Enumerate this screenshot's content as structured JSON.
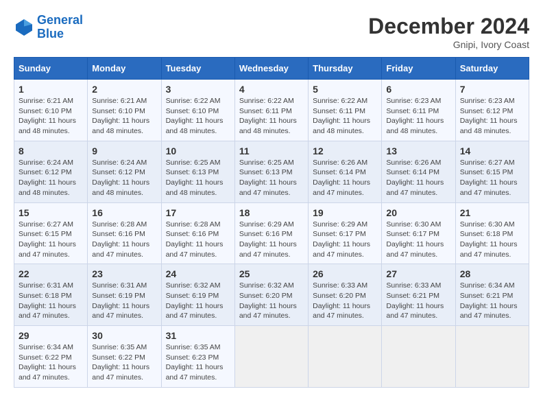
{
  "logo": {
    "line1": "General",
    "line2": "Blue"
  },
  "title": "December 2024",
  "subtitle": "Gnipi, Ivory Coast",
  "days_header": [
    "Sunday",
    "Monday",
    "Tuesday",
    "Wednesday",
    "Thursday",
    "Friday",
    "Saturday"
  ],
  "weeks": [
    [
      {
        "day": "1",
        "info": "Sunrise: 6:21 AM\nSunset: 6:10 PM\nDaylight: 11 hours\nand 48 minutes."
      },
      {
        "day": "2",
        "info": "Sunrise: 6:21 AM\nSunset: 6:10 PM\nDaylight: 11 hours\nand 48 minutes."
      },
      {
        "day": "3",
        "info": "Sunrise: 6:22 AM\nSunset: 6:10 PM\nDaylight: 11 hours\nand 48 minutes."
      },
      {
        "day": "4",
        "info": "Sunrise: 6:22 AM\nSunset: 6:11 PM\nDaylight: 11 hours\nand 48 minutes."
      },
      {
        "day": "5",
        "info": "Sunrise: 6:22 AM\nSunset: 6:11 PM\nDaylight: 11 hours\nand 48 minutes."
      },
      {
        "day": "6",
        "info": "Sunrise: 6:23 AM\nSunset: 6:11 PM\nDaylight: 11 hours\nand 48 minutes."
      },
      {
        "day": "7",
        "info": "Sunrise: 6:23 AM\nSunset: 6:12 PM\nDaylight: 11 hours\nand 48 minutes."
      }
    ],
    [
      {
        "day": "8",
        "info": "Sunrise: 6:24 AM\nSunset: 6:12 PM\nDaylight: 11 hours\nand 48 minutes."
      },
      {
        "day": "9",
        "info": "Sunrise: 6:24 AM\nSunset: 6:12 PM\nDaylight: 11 hours\nand 48 minutes."
      },
      {
        "day": "10",
        "info": "Sunrise: 6:25 AM\nSunset: 6:13 PM\nDaylight: 11 hours\nand 48 minutes."
      },
      {
        "day": "11",
        "info": "Sunrise: 6:25 AM\nSunset: 6:13 PM\nDaylight: 11 hours\nand 47 minutes."
      },
      {
        "day": "12",
        "info": "Sunrise: 6:26 AM\nSunset: 6:14 PM\nDaylight: 11 hours\nand 47 minutes."
      },
      {
        "day": "13",
        "info": "Sunrise: 6:26 AM\nSunset: 6:14 PM\nDaylight: 11 hours\nand 47 minutes."
      },
      {
        "day": "14",
        "info": "Sunrise: 6:27 AM\nSunset: 6:15 PM\nDaylight: 11 hours\nand 47 minutes."
      }
    ],
    [
      {
        "day": "15",
        "info": "Sunrise: 6:27 AM\nSunset: 6:15 PM\nDaylight: 11 hours\nand 47 minutes."
      },
      {
        "day": "16",
        "info": "Sunrise: 6:28 AM\nSunset: 6:16 PM\nDaylight: 11 hours\nand 47 minutes."
      },
      {
        "day": "17",
        "info": "Sunrise: 6:28 AM\nSunset: 6:16 PM\nDaylight: 11 hours\nand 47 minutes."
      },
      {
        "day": "18",
        "info": "Sunrise: 6:29 AM\nSunset: 6:16 PM\nDaylight: 11 hours\nand 47 minutes."
      },
      {
        "day": "19",
        "info": "Sunrise: 6:29 AM\nSunset: 6:17 PM\nDaylight: 11 hours\nand 47 minutes."
      },
      {
        "day": "20",
        "info": "Sunrise: 6:30 AM\nSunset: 6:17 PM\nDaylight: 11 hours\nand 47 minutes."
      },
      {
        "day": "21",
        "info": "Sunrise: 6:30 AM\nSunset: 6:18 PM\nDaylight: 11 hours\nand 47 minutes."
      }
    ],
    [
      {
        "day": "22",
        "info": "Sunrise: 6:31 AM\nSunset: 6:18 PM\nDaylight: 11 hours\nand 47 minutes."
      },
      {
        "day": "23",
        "info": "Sunrise: 6:31 AM\nSunset: 6:19 PM\nDaylight: 11 hours\nand 47 minutes."
      },
      {
        "day": "24",
        "info": "Sunrise: 6:32 AM\nSunset: 6:19 PM\nDaylight: 11 hours\nand 47 minutes."
      },
      {
        "day": "25",
        "info": "Sunrise: 6:32 AM\nSunset: 6:20 PM\nDaylight: 11 hours\nand 47 minutes."
      },
      {
        "day": "26",
        "info": "Sunrise: 6:33 AM\nSunset: 6:20 PM\nDaylight: 11 hours\nand 47 minutes."
      },
      {
        "day": "27",
        "info": "Sunrise: 6:33 AM\nSunset: 6:21 PM\nDaylight: 11 hours\nand 47 minutes."
      },
      {
        "day": "28",
        "info": "Sunrise: 6:34 AM\nSunset: 6:21 PM\nDaylight: 11 hours\nand 47 minutes."
      }
    ],
    [
      {
        "day": "29",
        "info": "Sunrise: 6:34 AM\nSunset: 6:22 PM\nDaylight: 11 hours\nand 47 minutes."
      },
      {
        "day": "30",
        "info": "Sunrise: 6:35 AM\nSunset: 6:22 PM\nDaylight: 11 hours\nand 47 minutes."
      },
      {
        "day": "31",
        "info": "Sunrise: 6:35 AM\nSunset: 6:23 PM\nDaylight: 11 hours\nand 47 minutes."
      },
      null,
      null,
      null,
      null
    ]
  ]
}
